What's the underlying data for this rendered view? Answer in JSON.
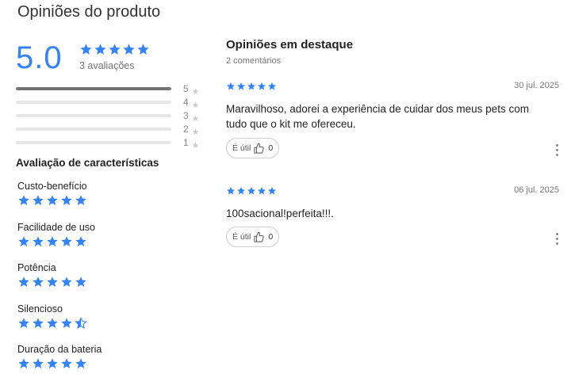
{
  "page_title": "Opiniões do produto",
  "summary": {
    "score": "5.0",
    "avg_stars": 5,
    "count_text": "3 avaliações",
    "distribution": [
      {
        "label": "5",
        "fraction": 1.0
      },
      {
        "label": "4",
        "fraction": 0
      },
      {
        "label": "3",
        "fraction": 0
      },
      {
        "label": "2",
        "fraction": 0
      },
      {
        "label": "1",
        "fraction": 0
      }
    ]
  },
  "characteristics": {
    "title": "Avaliação de características",
    "items": [
      {
        "label": "Custo-benefício",
        "rating": 5
      },
      {
        "label": "Facilidade de uso",
        "rating": 5
      },
      {
        "label": "Potência",
        "rating": 5
      },
      {
        "label": "Silencioso",
        "rating": 4.5
      },
      {
        "label": "Duração da bateria",
        "rating": 5
      }
    ]
  },
  "featured": {
    "title": "Opiniões em destaque",
    "count_text": "2 comentários",
    "reviews": [
      {
        "rating": 5,
        "date": "30 jul. 2025",
        "text": "Maravilhoso, adorei a experiência de cuidar dos meus pets com tudo que o kit me ofereceu.",
        "helpful_label": "É útil",
        "helpful_count": "0"
      },
      {
        "rating": 5,
        "date": "06 jul. 2025",
        "text": "100sacional!perfeita!!!.",
        "helpful_label": "É útil",
        "helpful_count": "0"
      }
    ]
  },
  "colors": {
    "star_filled": "#3483fa",
    "star_empty": "#cccccc",
    "bar_fill": "#737373",
    "score": "#3483fa"
  },
  "icons": {
    "star": "star-icon",
    "thumbs_up": "thumbs-up-icon",
    "more": "more-options-icon"
  }
}
